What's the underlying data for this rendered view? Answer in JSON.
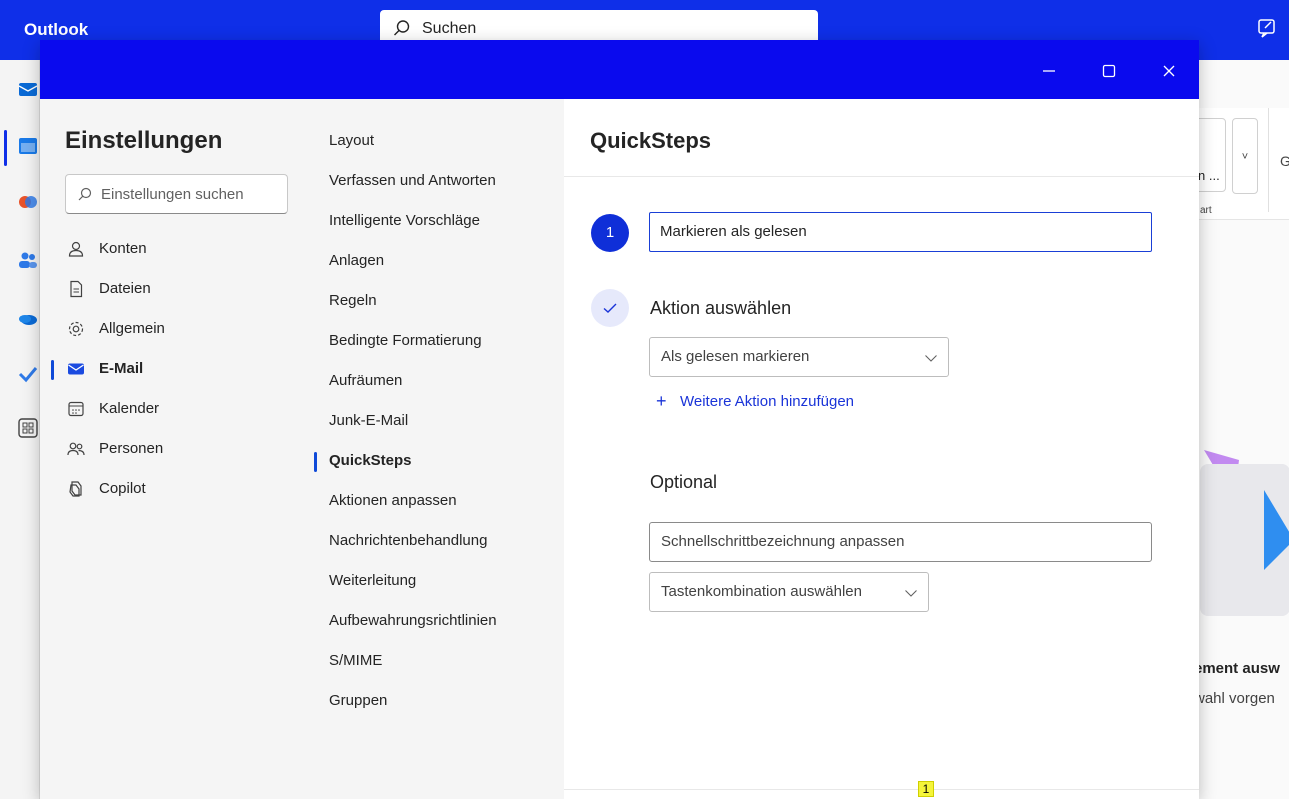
{
  "app": {
    "name": "Outlook"
  },
  "search": {
    "placeholder": "Suchen"
  },
  "background": {
    "ribbon_text1": "n ...",
    "ribbon_text2": "art",
    "ribbon_g": "G",
    "ribbon_dd": "˅",
    "message_title": "ement ausw",
    "message_sub": "wahl vorgen"
  },
  "settings": {
    "title": "Einstellungen",
    "search_placeholder": "Einstellungen suchen",
    "nav": [
      {
        "label": "Konten",
        "icon": "person-icon"
      },
      {
        "label": "Dateien",
        "icon": "document-icon"
      },
      {
        "label": "Allgemein",
        "icon": "gear-icon"
      },
      {
        "label": "E-Mail",
        "icon": "mail-icon",
        "active": true
      },
      {
        "label": "Kalender",
        "icon": "calendar-icon"
      },
      {
        "label": "Personen",
        "icon": "people-icon"
      },
      {
        "label": "Copilot",
        "icon": "copilot-icon"
      }
    ],
    "subnav": [
      "Layout",
      "Verfassen und Antworten",
      "Intelligente Vorschläge",
      "Anlagen",
      "Regeln",
      "Bedingte Formatierung",
      "Aufräumen",
      "Junk-E-Mail",
      "QuickSteps",
      "Aktionen anpassen",
      "Nachrichtenbehandlung",
      "Weiterleitung",
      "Aufbewahrungsrichtlinien",
      "S/MIME",
      "Gruppen"
    ],
    "subnav_active": "QuickSteps"
  },
  "quicksteps": {
    "title": "QuickSteps",
    "step_number": "1",
    "name_value": "Markieren als gelesen",
    "action_label": "Aktion auswählen",
    "action_select": "Als gelesen markieren",
    "add_action": "Weitere Aktion hinzufügen",
    "optional_label": "Optional",
    "custom_placeholder": "Schnellschrittbezeichnung anpassen",
    "shortcut_select": "Tastenkombination auswählen"
  },
  "badge": "1",
  "colors": {
    "brand": "#0f2fe8",
    "accent": "#1a34d8"
  }
}
